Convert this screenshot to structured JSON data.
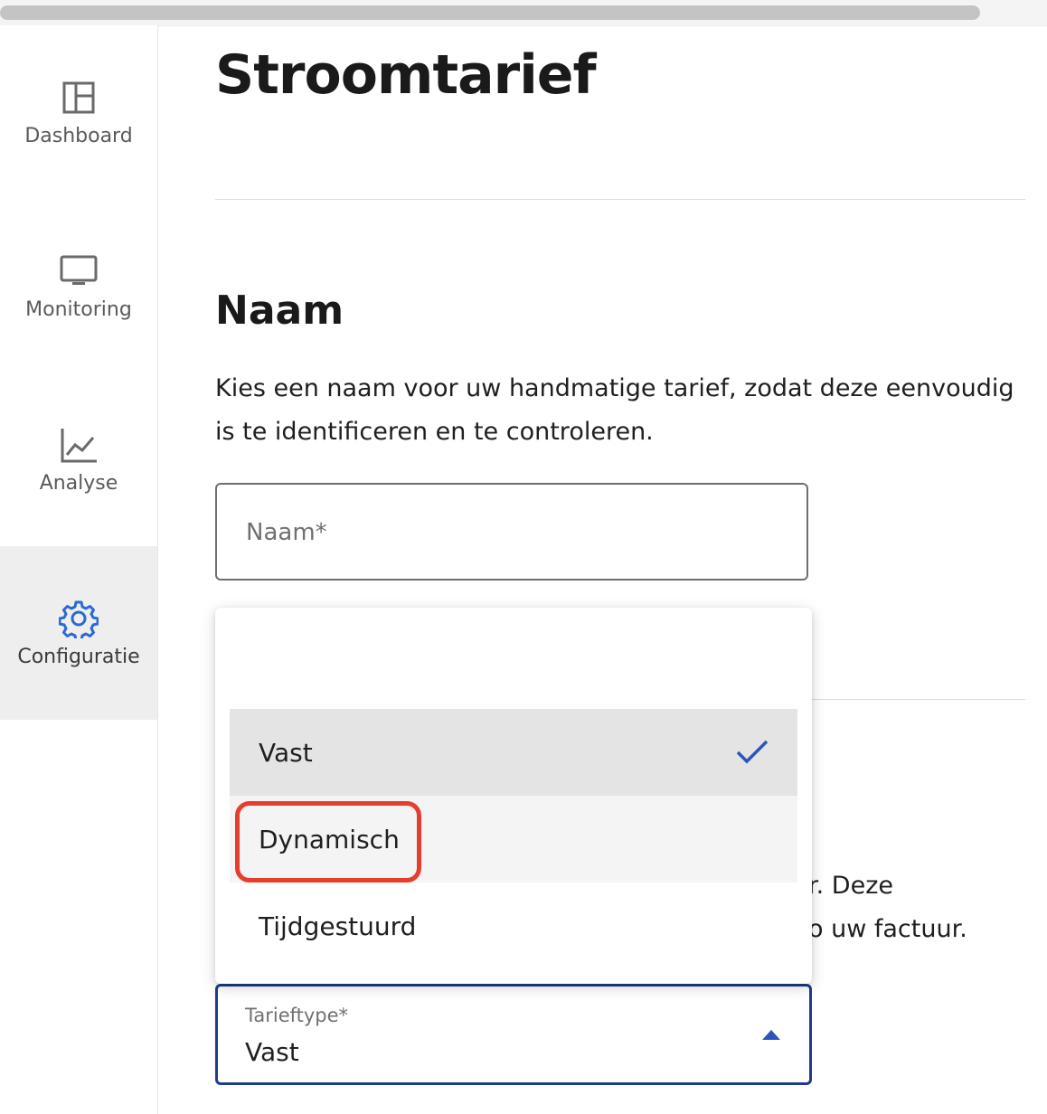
{
  "page": {
    "title": "Stroomtarief"
  },
  "sidebar": {
    "items": [
      {
        "label": "Dashboard",
        "icon": "dashboard-icon",
        "active": false
      },
      {
        "label": "Monitoring",
        "icon": "monitor-icon",
        "active": false
      },
      {
        "label": "Analyse",
        "icon": "chart-line-icon",
        "active": false
      },
      {
        "label": "Configuratie",
        "icon": "gear-icon",
        "active": true
      }
    ]
  },
  "naam_section": {
    "title": "Naam",
    "description": "Kies een naam voor uw handmatige tarief, zodat deze eenvoudig is te identificeren en te controleren.",
    "input_placeholder": "Naam*"
  },
  "obscured_text": {
    "line1": "r. Deze",
    "line2": "o uw factuur."
  },
  "tarieftype": {
    "label": "Tarieftype*",
    "value": "Vast",
    "options": [
      {
        "label": "Vast",
        "selected": true
      },
      {
        "label": "Dynamisch",
        "highlighted": true
      },
      {
        "label": "Tijdgestuurd"
      }
    ]
  },
  "colors": {
    "accent": "#1e3e8c",
    "check": "#2b56b8",
    "highlight": "#e53e2e",
    "active_icon": "#2a6ad4"
  }
}
